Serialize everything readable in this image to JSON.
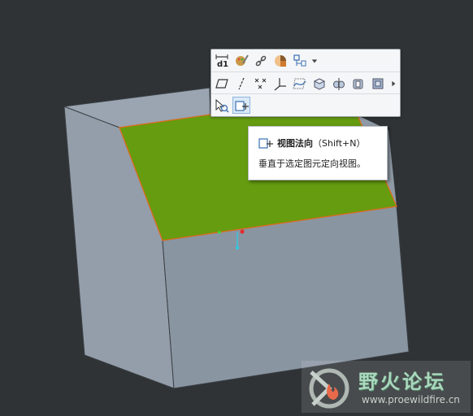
{
  "toolbar": {
    "row1": [
      {
        "name": "dimension-icon"
      },
      {
        "name": "appearance-brush-icon"
      },
      {
        "name": "chain-link-icon"
      },
      {
        "name": "shading-sphere-icon"
      },
      {
        "name": "select-filter-icon"
      },
      {
        "name": "dropdown-arrow-icon"
      }
    ],
    "row2": [
      {
        "name": "datum-plane-icon"
      },
      {
        "name": "datum-axis-icon"
      },
      {
        "name": "datum-point-icon"
      },
      {
        "name": "coordinate-system-icon"
      },
      {
        "name": "sketch-icon"
      },
      {
        "name": "extrude-icon"
      },
      {
        "name": "revolve-icon"
      },
      {
        "name": "shell-icon"
      },
      {
        "name": "thicken-icon"
      },
      {
        "name": "more-arrow-icon"
      }
    ],
    "row3": [
      {
        "name": "zoom-to-selected-icon"
      },
      {
        "name": "view-normal-icon"
      }
    ]
  },
  "tooltip": {
    "title": "视图法向",
    "shortcut": "（Shift+N）",
    "description": "垂直于选定图元定向视图。"
  },
  "watermark": {
    "title": "野火论坛",
    "url": "www.proewildfire.cn"
  },
  "colors": {
    "background": "#2f3335",
    "model_face": "#8a95a2",
    "model_top": "#6a9a12",
    "highlight_edge": "#e36a1a",
    "toolbar_bg": "#f4f6f8"
  }
}
